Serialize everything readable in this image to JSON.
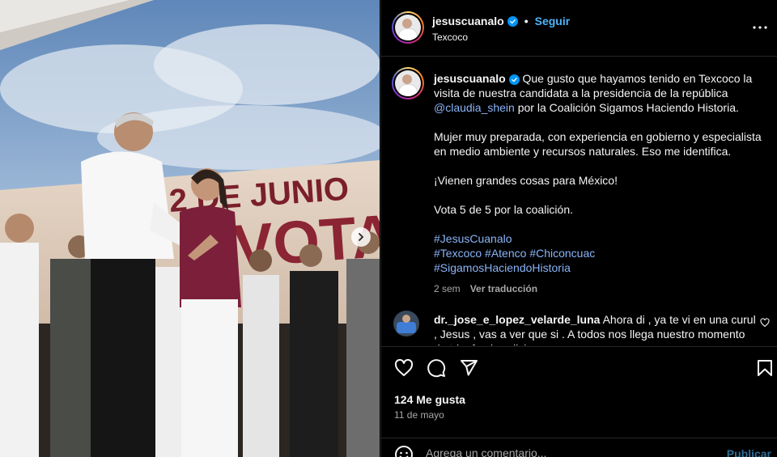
{
  "post": {
    "username": "jesuscuanalo",
    "follow_label": "Seguir",
    "location": "Texcoco",
    "banner_text": "2 DE JUNIO",
    "banner_text_2": "VOTA"
  },
  "caption": {
    "username": "jesuscuanalo",
    "line1_a": "Que gusto que hayamos tenido en Texcoco la visita de nuestra candidata a la presidencia de la república",
    "mention": "@claudia_shein",
    "line1_b": "por la Coalición Sigamos Haciendo Historia.",
    "para2": "Mujer muy preparada, con experiencia en gobierno y especialista en medio ambiente y recursos naturales. Eso me identifica.",
    "para3": "¡Vienen grandes cosas para México!",
    "para4": "Vota 5 de 5 por la coalición.",
    "hashtag1": "#JesusCuanalo",
    "hashtag2": "#Texcoco",
    "hashtag3": "#Atenco",
    "hashtag4": "#Chiconcuac",
    "hashtag5": "#SigamosHaciendoHistoria",
    "time": "2 sem",
    "translate": "Ver traducción"
  },
  "comment": {
    "username": "dr._jose_e_lopez_velarde_luna",
    "text": "Ahora di , ya te vi en una curul , Jesus , vas a ver que si . A todos nos llega nuestro momento de triunfo , bendiciones"
  },
  "stats": {
    "likes": "124 Me gusta",
    "date": "11 de mayo"
  },
  "composer": {
    "placeholder": "Agrega un comentario...",
    "publish": "Publicar"
  },
  "icons": {
    "like": "heart-icon",
    "comment": "comment-icon",
    "share": "share-icon",
    "save": "bookmark-icon",
    "more": "more-icon",
    "emoji": "emoji-icon",
    "next": "chevron-right-icon",
    "verified": "verified-badge-icon"
  },
  "colors": {
    "accent": "#0095f6",
    "link": "#4cb5f9",
    "background": "#000000"
  }
}
